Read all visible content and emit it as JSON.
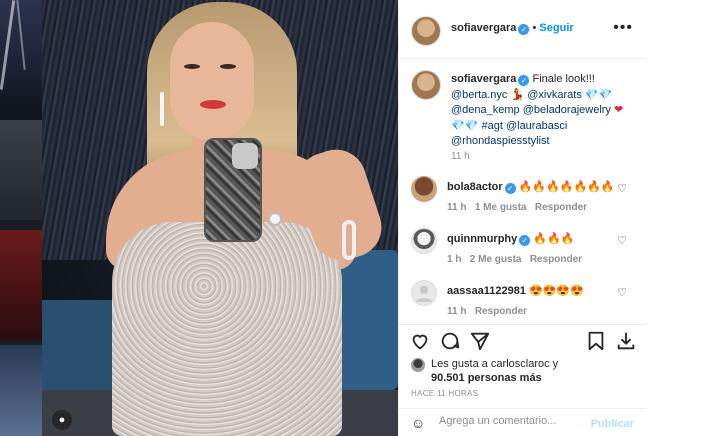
{
  "post": {
    "username": "sofiavergara",
    "follow_label": "Seguir",
    "dot": "•",
    "more_label": "•••",
    "caption_text": "Finale look!!!",
    "caption_lines": [
      "@berta.nyc",
      "@xivkarats",
      "@dena_kemp",
      "@beladorajewelry",
      "#agt",
      "@laurabasci",
      "@rhondaspiesstylist"
    ],
    "caption_time": "11 h"
  },
  "comments": [
    {
      "username": "bola8actor",
      "text": "🔥🔥🔥🔥🔥🔥🔥",
      "time": "11 h",
      "likes": "1 Me gusta",
      "reply": "Responder"
    },
    {
      "username": "quinnmurphy",
      "text": "🔥🔥🔥",
      "time": "1 h",
      "likes": "2 Me gusta",
      "reply": "Responder"
    },
    {
      "username": "aassaa1122981",
      "text": "😍😍😍😍",
      "time": "11 h",
      "likes": "",
      "reply": "Responder"
    }
  ],
  "likes": {
    "line1": "Les gusta a carlosclaroc y",
    "line2": "90.501 personas más"
  },
  "timestamp": "HACE 11 HORAS",
  "comment_box": {
    "placeholder": "Agrega un comentario...",
    "publish": "Publicar"
  },
  "colors": {
    "accent": "#0095f6",
    "verified": "#3897f0",
    "publish_disabled": "#b2dffc"
  },
  "icons": {
    "verified": "verified-badge-icon",
    "heart": "heart-icon",
    "comment": "comment-icon",
    "share": "share-icon",
    "save": "bookmark-icon",
    "download": "download-icon",
    "emoji": "emoji-icon",
    "user_tag": "user-tag-icon"
  }
}
